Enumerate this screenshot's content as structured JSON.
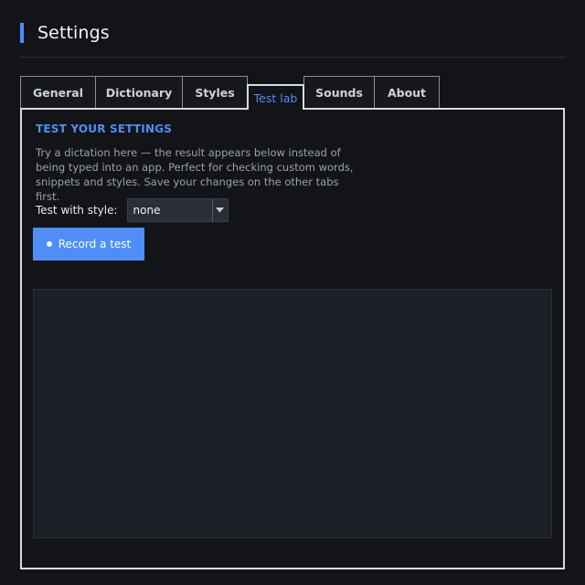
{
  "header": {
    "title": "Settings",
    "accent_color": "#4f8ef7"
  },
  "tabs": [
    {
      "label": "General",
      "active": false
    },
    {
      "label": "Dictionary",
      "active": false
    },
    {
      "label": "Styles",
      "active": false
    },
    {
      "label": "Test lab",
      "active": true
    },
    {
      "label": "Sounds",
      "active": false
    },
    {
      "label": "About",
      "active": false
    }
  ],
  "test_lab": {
    "section_title": "TEST YOUR SETTINGS",
    "description": "Try a dictation here — the result appears below instead of being typed into an app. Perfect for checking custom words, snippets and styles. Save your changes on the other tabs first.",
    "style_label": "Test with style:",
    "style_value": "none",
    "record_button_label": "Record a test",
    "record_icon": "record-dot-icon",
    "result_text": ""
  }
}
